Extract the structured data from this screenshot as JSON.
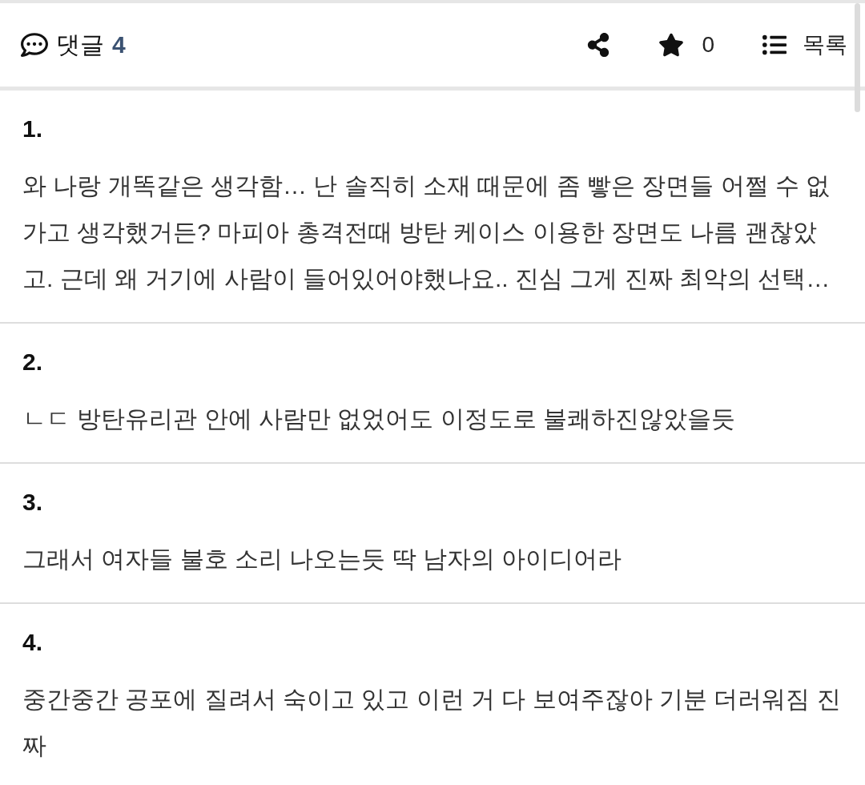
{
  "header": {
    "title": "댓글",
    "count": "4",
    "actions": [
      {
        "kind": "share"
      },
      {
        "kind": "favorite",
        "count": "0"
      },
      {
        "kind": "list",
        "label": "목록"
      }
    ]
  },
  "comments": [
    {
      "number": "1.",
      "text": "와 나랑 개똑같은 생각함… 난 솔직히 소재 때문에 좀 빻은 장면들 어쩔 수 없가고 생각했거든? 마피아 총격전때 방탄 케이스 이용한 장면도 나름 괜찮았고. 근데 왜 거기에 사람이 들어있어야했나요.. 진심 그게 진짜 최악의 선택…"
    },
    {
      "number": "2.",
      "text": "ㄴㄷ 방탄유리관 안에 사람만 없었어도 이정도로 불쾌하진않았을듯"
    },
    {
      "number": "3.",
      "text": "그래서 여자들 불호 소리 나오는듯 딱 남자의 아이디어라"
    },
    {
      "number": "4.",
      "text": "중간중간 공포에 질려서 숙이고 있고 이런 거 다 보여주잖아 기분 더러워짐 진짜"
    }
  ]
}
